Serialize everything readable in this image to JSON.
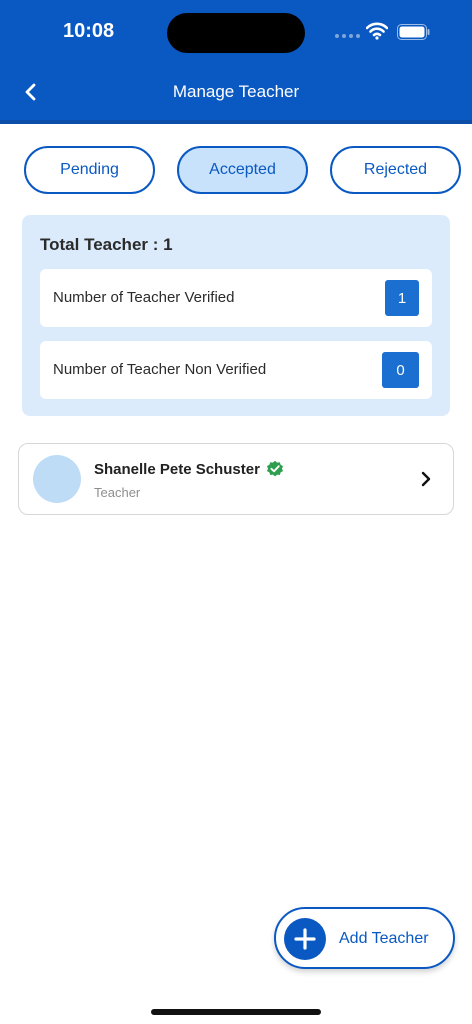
{
  "status_bar": {
    "time": "10:08"
  },
  "header": {
    "title": "Manage Teacher",
    "back_icon": "chevron-left-icon"
  },
  "tabs": [
    {
      "label": "Pending",
      "active": false
    },
    {
      "label": "Accepted",
      "active": true
    },
    {
      "label": "Rejected",
      "active": false
    }
  ],
  "summary": {
    "title": "Total Teacher : 1",
    "rows": [
      {
        "label": "Number of Teacher Verified",
        "count": "1"
      },
      {
        "label": "Number of Teacher Non Verified",
        "count": "0"
      }
    ]
  },
  "teachers": [
    {
      "name": "Shanelle Pete Schuster",
      "role": "Teacher",
      "verified": true
    }
  ],
  "fab": {
    "label": "Add Teacher",
    "icon": "plus-icon"
  },
  "colors": {
    "primary": "#0a59c2",
    "tab_active_bg": "#c8e2fb",
    "summary_bg": "#dcebfb",
    "badge": "#1a6fd0",
    "verified": "#2e9e4f"
  }
}
